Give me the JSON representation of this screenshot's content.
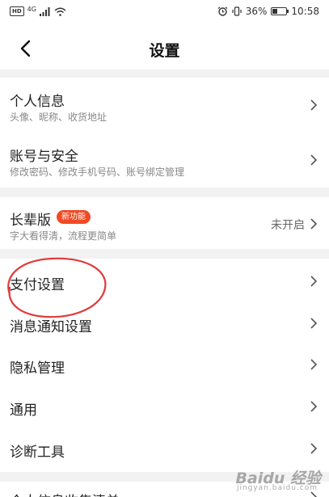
{
  "status_bar": {
    "hd_badge": "HD",
    "network": "4G",
    "battery_level_percent": 36,
    "battery_text": "36%",
    "time": "10:58"
  },
  "header": {
    "title": "设置"
  },
  "groups": [
    {
      "items": [
        {
          "title": "个人信息",
          "subtitle": "头像、昵称、收货地址"
        },
        {
          "title": "账号与安全",
          "subtitle": "修改密码、修改手机号码、账号绑定管理"
        }
      ]
    },
    {
      "items": [
        {
          "title": "长辈版",
          "badge": "新功能",
          "subtitle": "字大看得清，流程更简单",
          "value": "未开启"
        }
      ]
    },
    {
      "items": [
        {
          "title": "支付设置"
        },
        {
          "title": "消息通知设置"
        },
        {
          "title": "隐私管理"
        },
        {
          "title": "通用"
        },
        {
          "title": "诊断工具"
        }
      ]
    },
    {
      "items": [
        {
          "title": "个人信息收集清单"
        }
      ]
    }
  ],
  "annotation": {
    "color": "#e23a3a"
  },
  "watermark": {
    "brand": "Baidu 经验",
    "sub": "jingyan.baidu.com"
  },
  "colors": {
    "background": "#f2f2f2",
    "badge": "#f04a24",
    "chevron": "#555555"
  }
}
